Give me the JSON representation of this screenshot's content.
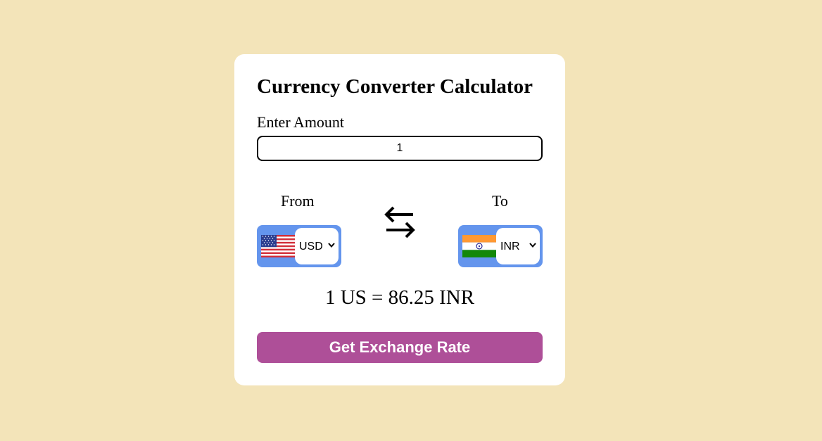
{
  "converter": {
    "title": "Currency Converter Calculator",
    "amount_label": "Enter Amount",
    "amount_value": "1",
    "from_label": "From",
    "to_label": "To",
    "from_currency": "USD",
    "to_currency": "INR",
    "from_flag_icon": "us-flag-icon",
    "to_flag_icon": "india-flag-icon",
    "swap_icon": "swap-arrows-icon",
    "result_text": "1 US = 86.25 INR",
    "button_label": "Get Exchange Rate"
  },
  "colors": {
    "page_background": "#f3e4b9",
    "card_background": "#ffffff",
    "currency_box": "#6495ed",
    "button_background": "#ae4f98",
    "button_text": "#ffffff"
  }
}
